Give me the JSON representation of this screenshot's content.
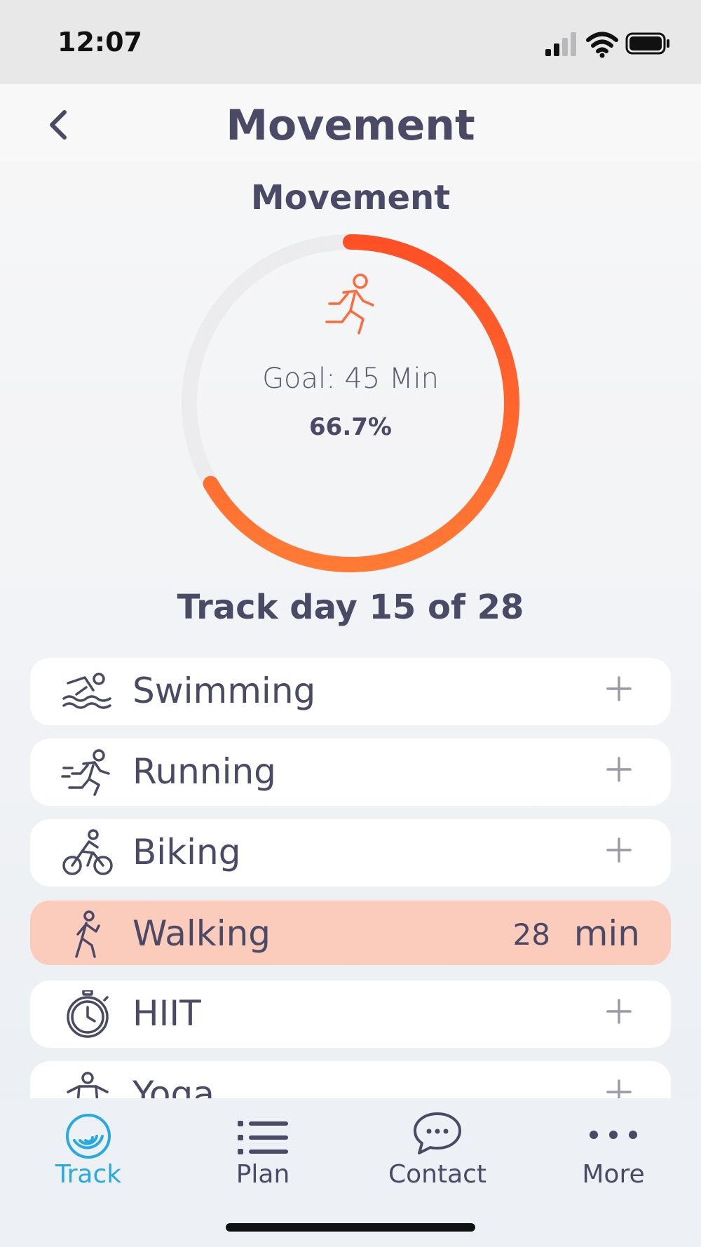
{
  "status_bar": {
    "time": "12:07",
    "icons": [
      "cellular-signal-icon",
      "wifi-icon",
      "battery-icon"
    ]
  },
  "header": {
    "title": "Movement",
    "back_icon": "chevron-left-icon"
  },
  "summary": {
    "title": "Movement",
    "goal_text": "Goal: 45 Min",
    "percent_text": "66.7%",
    "progress_fraction": 0.667,
    "icon": "running-person-icon",
    "track_day_text": "Track day 15 of 28"
  },
  "activities": [
    {
      "label": "Swimming",
      "icon": "swimming-icon",
      "action": "+"
    },
    {
      "label": "Running",
      "icon": "running-icon",
      "action": "+"
    },
    {
      "label": "Biking",
      "icon": "biking-icon",
      "action": "+"
    },
    {
      "label": "Walking",
      "icon": "walking-icon",
      "value": "28",
      "unit": "min",
      "active": true
    },
    {
      "label": "HIIT",
      "icon": "stopwatch-icon",
      "action": "+"
    },
    {
      "label": "Yoga",
      "icon": "yoga-icon",
      "action": "+"
    }
  ],
  "tabs": [
    {
      "label": "Track",
      "icon": "track-icon",
      "active": true
    },
    {
      "label": "Plan",
      "icon": "list-icon"
    },
    {
      "label": "Contact",
      "icon": "chat-bubble-icon"
    },
    {
      "label": "More",
      "icon": "more-dots-icon"
    }
  ],
  "colors": {
    "accent_orange": "#ff5a2a",
    "accent_orange_light": "#ff7a3d",
    "active_row": "#fbcbbc",
    "tab_active": "#27a9e1",
    "text_primary": "#4a4a66",
    "ring_track": "#ececee"
  }
}
